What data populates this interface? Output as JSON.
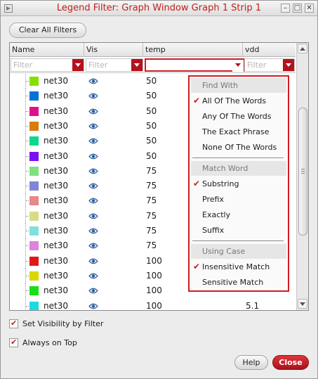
{
  "window": {
    "title": "Legend Filter: Graph Window Graph 1 Strip 1",
    "controls": [
      "–",
      "□",
      "✕"
    ]
  },
  "toolbar": {
    "clear_all_label": "Clear All Filters"
  },
  "table": {
    "columns": [
      "Name",
      "Vis",
      "temp",
      "vdd"
    ],
    "filter_placeholder": "Filter",
    "rows": [
      {
        "name": "net30",
        "color": "#84e000",
        "temp": "50",
        "vdd": ""
      },
      {
        "name": "net30",
        "color": "#0073d6",
        "temp": "50",
        "vdd": ""
      },
      {
        "name": "net30",
        "color": "#e0108a",
        "temp": "50",
        "vdd": ""
      },
      {
        "name": "net30",
        "color": "#d87c08",
        "temp": "50",
        "vdd": ""
      },
      {
        "name": "net30",
        "color": "#0ad88a",
        "temp": "50",
        "vdd": ""
      },
      {
        "name": "net30",
        "color": "#7a10f0",
        "temp": "50",
        "vdd": ""
      },
      {
        "name": "net30",
        "color": "#7fe07f",
        "temp": "75",
        "vdd": ""
      },
      {
        "name": "net30",
        "color": "#7f86d8",
        "temp": "75",
        "vdd": ""
      },
      {
        "name": "net30",
        "color": "#e88888",
        "temp": "75",
        "vdd": ""
      },
      {
        "name": "net30",
        "color": "#d8dc88",
        "temp": "75",
        "vdd": ""
      },
      {
        "name": "net30",
        "color": "#80e0dc",
        "temp": "75",
        "vdd": ""
      },
      {
        "name": "net30",
        "color": "#dc84dc",
        "temp": "75",
        "vdd": ""
      },
      {
        "name": "net30",
        "color": "#e01818",
        "temp": "100",
        "vdd": ""
      },
      {
        "name": "net30",
        "color": "#d8d800",
        "temp": "100",
        "vdd": ""
      },
      {
        "name": "net30",
        "color": "#18e018",
        "temp": "100",
        "vdd": ""
      },
      {
        "name": "net30",
        "color": "#18dce0",
        "temp": "100",
        "vdd": "5.1"
      }
    ]
  },
  "popup": {
    "sections": [
      {
        "header": "Find With",
        "items": [
          {
            "label": "All Of The Words",
            "checked": true
          },
          {
            "label": "Any Of The Words",
            "checked": false
          },
          {
            "label": "The Exact Phrase",
            "checked": false
          },
          {
            "label": "None Of The Words",
            "checked": false
          }
        ]
      },
      {
        "header": "Match Word",
        "items": [
          {
            "label": "Substring",
            "checked": true
          },
          {
            "label": "Prefix",
            "checked": false
          },
          {
            "label": "Exactly",
            "checked": false
          },
          {
            "label": "Suffix",
            "checked": false
          }
        ]
      },
      {
        "header": "Using Case",
        "items": [
          {
            "label": "Insensitive Match",
            "checked": true
          },
          {
            "label": "Sensitive Match",
            "checked": false
          }
        ]
      }
    ],
    "check_glyph": "✔"
  },
  "options": {
    "set_visibility_label": "Set Visibility by Filter",
    "always_on_top_label": "Always on Top"
  },
  "footer": {
    "help_label": "Help",
    "close_label": "Close"
  },
  "colors": {
    "accent": "#d21c24",
    "title": "#c0201a",
    "dropdown": "#b5121b"
  }
}
